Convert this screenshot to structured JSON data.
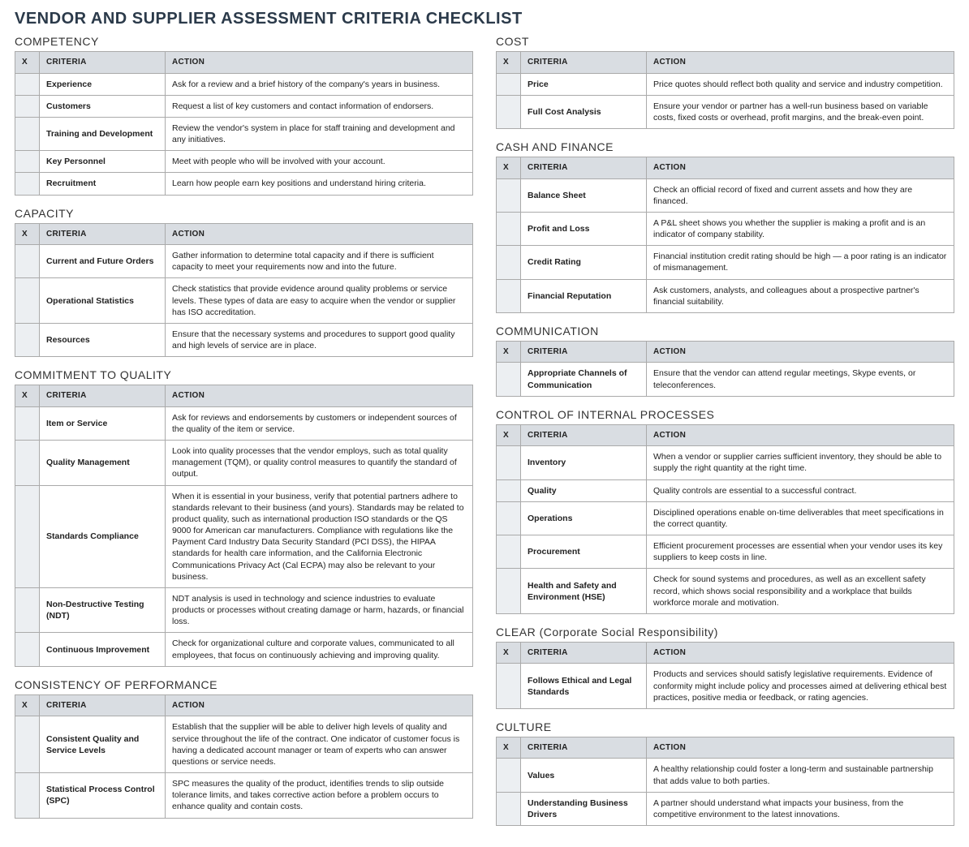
{
  "title": "VENDOR AND SUPPLIER ASSESSMENT CRITERIA CHECKLIST",
  "headers": {
    "x": "X",
    "criteria": "CRITERIA",
    "action": "ACTION"
  },
  "left": [
    {
      "title": "COMPETENCY",
      "rows": [
        {
          "criteria": "Experience",
          "action": "Ask for a review and a brief history of the company's years in business."
        },
        {
          "criteria": "Customers",
          "action": "Request a list of key customers and contact information of endorsers."
        },
        {
          "criteria": "Training and Development",
          "action": "Review the vendor's system in place for staff training and development and any initiatives."
        },
        {
          "criteria": "Key Personnel",
          "action": "Meet with people who will be involved with your account."
        },
        {
          "criteria": "Recruitment",
          "action": "Learn how people earn key positions and understand hiring criteria."
        }
      ]
    },
    {
      "title": "CAPACITY",
      "rows": [
        {
          "criteria": "Current and Future Orders",
          "action": "Gather information to determine total capacity and if there is sufficient capacity to meet your requirements now and into the future."
        },
        {
          "criteria": "Operational Statistics",
          "action": "Check statistics that provide evidence around quality problems or service levels. These types of data are easy to acquire when the vendor or supplier has ISO accreditation."
        },
        {
          "criteria": "Resources",
          "action": "Ensure that the necessary systems and procedures to support good quality and high levels of service are in place."
        }
      ]
    },
    {
      "title": "COMMITMENT TO QUALITY",
      "rows": [
        {
          "criteria": "Item or Service",
          "action": "Ask for reviews and endorsements by customers or independent sources of the quality of the item or service."
        },
        {
          "criteria": "Quality Management",
          "action": "Look into quality processes that the vendor employs, such as total quality management (TQM), or quality control measures to quantify the standard of output."
        },
        {
          "criteria": "Standards Compliance",
          "action": "When it is essential in your business, verify that potential partners adhere to standards relevant to their business (and yours). Standards may be related to product quality, such as international production ISO standards or the QS 9000 for American car manufacturers. Compliance with regulations like the Payment Card Industry Data Security Standard (PCI DSS), the HIPAA standards for health care information, and the California Electronic Communications Privacy Act (Cal ECPA) may also be relevant to your business."
        },
        {
          "criteria": "Non-Destructive Testing (NDT)",
          "action": "NDT analysis is used in technology and science industries to evaluate products or processes without creating damage or harm, hazards, or financial loss."
        },
        {
          "criteria": "Continuous Improvement",
          "action": "Check for organizational culture and corporate values, communicated to all employees, that focus on continuously achieving and improving quality."
        }
      ]
    },
    {
      "title": "CONSISTENCY OF PERFORMANCE",
      "rows": [
        {
          "criteria": "Consistent Quality and Service Levels",
          "action": "Establish that the supplier will be able to deliver high levels of quality and service throughout the life of the contract. One indicator of customer focus is having a dedicated account manager or team of experts who can answer questions or service needs."
        },
        {
          "criteria": "Statistical Process Control (SPC)",
          "action": "SPC measures the quality of the product, identifies trends to slip outside tolerance limits, and takes corrective action before a problem occurs to enhance quality and contain costs."
        }
      ]
    }
  ],
  "right": [
    {
      "title": "COST",
      "rows": [
        {
          "criteria": "Price",
          "action": "Price quotes should reflect both quality and service and industry competition."
        },
        {
          "criteria": "Full Cost Analysis",
          "action": "Ensure your vendor or partner has a well-run business based on variable costs, fixed costs or overhead, profit margins, and the break-even point."
        }
      ]
    },
    {
      "title": "CASH AND FINANCE",
      "rows": [
        {
          "criteria": "Balance Sheet",
          "action": "Check an official record of fixed and current assets and how they are financed."
        },
        {
          "criteria": "Profit and Loss",
          "action": "A P&L sheet shows you whether the supplier is making a profit and is an indicator of company stability."
        },
        {
          "criteria": "Credit Rating",
          "action": "Financial institution credit rating should be high — a poor rating is an indicator of mismanagement."
        },
        {
          "criteria": "Financial Reputation",
          "action": "Ask customers, analysts, and colleagues about a prospective partner's financial suitability."
        }
      ]
    },
    {
      "title": "COMMUNICATION",
      "rows": [
        {
          "criteria": "Appropriate Channels of Communication",
          "action": "Ensure that the vendor can attend regular meetings, Skype events, or teleconferences."
        }
      ]
    },
    {
      "title": "CONTROL OF INTERNAL PROCESSES",
      "rows": [
        {
          "criteria": "Inventory",
          "action": "When a vendor or supplier carries sufficient inventory, they should be able to supply the right quantity at the right time."
        },
        {
          "criteria": "Quality",
          "action": "Quality controls are essential to a successful contract."
        },
        {
          "criteria": "Operations",
          "action": "Disciplined operations enable on-time deliverables that meet specifications in the correct quantity."
        },
        {
          "criteria": "Procurement",
          "action": "Efficient procurement processes are essential when your vendor uses its key suppliers to keep costs in line."
        },
        {
          "criteria": "Health and Safety and Environment (HSE)",
          "action": "Check for sound systems and procedures, as well as an excellent safety record, which shows social responsibility and a workplace that builds workforce morale and motivation."
        }
      ]
    },
    {
      "title": "CLEAR (Corporate Social Responsibility)",
      "rows": [
        {
          "criteria": "Follows Ethical and Legal Standards",
          "action": "Products and services should satisfy legislative requirements. Evidence of conformity might include policy and processes aimed at delivering ethical best practices, positive media or feedback, or rating agencies."
        }
      ]
    },
    {
      "title": "CULTURE",
      "rows": [
        {
          "criteria": "Values",
          "action": "A healthy relationship could foster a long-term and sustainable partnership that adds value to both parties."
        },
        {
          "criteria": "Understanding Business Drivers",
          "action": "A partner should understand what impacts your business, from the competitive environment to the latest innovations."
        }
      ]
    }
  ]
}
